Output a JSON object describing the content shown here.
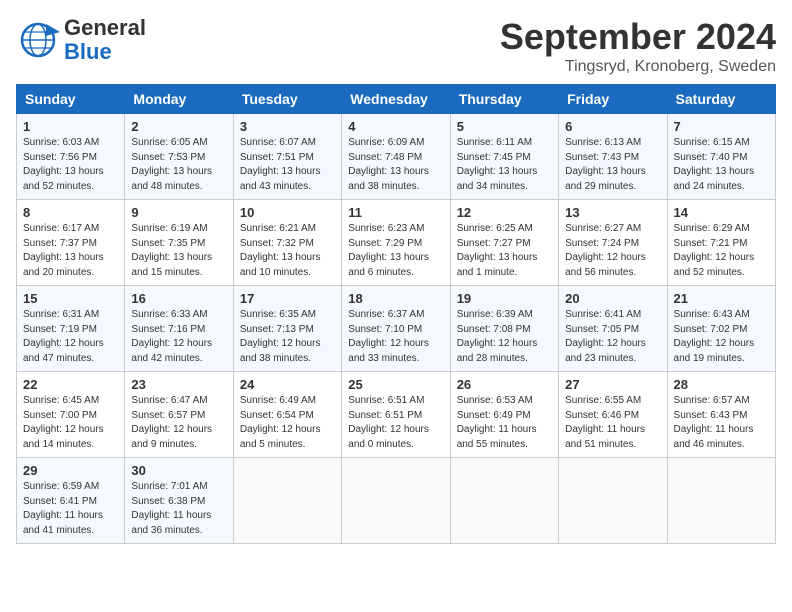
{
  "header": {
    "logo_general": "General",
    "logo_blue": "Blue",
    "month_title": "September 2024",
    "location": "Tingsryd, Kronoberg, Sweden"
  },
  "weekdays": [
    "Sunday",
    "Monday",
    "Tuesday",
    "Wednesday",
    "Thursday",
    "Friday",
    "Saturday"
  ],
  "weeks": [
    [
      {
        "day": "1",
        "info": "Sunrise: 6:03 AM\nSunset: 7:56 PM\nDaylight: 13 hours\nand 52 minutes."
      },
      {
        "day": "2",
        "info": "Sunrise: 6:05 AM\nSunset: 7:53 PM\nDaylight: 13 hours\nand 48 minutes."
      },
      {
        "day": "3",
        "info": "Sunrise: 6:07 AM\nSunset: 7:51 PM\nDaylight: 13 hours\nand 43 minutes."
      },
      {
        "day": "4",
        "info": "Sunrise: 6:09 AM\nSunset: 7:48 PM\nDaylight: 13 hours\nand 38 minutes."
      },
      {
        "day": "5",
        "info": "Sunrise: 6:11 AM\nSunset: 7:45 PM\nDaylight: 13 hours\nand 34 minutes."
      },
      {
        "day": "6",
        "info": "Sunrise: 6:13 AM\nSunset: 7:43 PM\nDaylight: 13 hours\nand 29 minutes."
      },
      {
        "day": "7",
        "info": "Sunrise: 6:15 AM\nSunset: 7:40 PM\nDaylight: 13 hours\nand 24 minutes."
      }
    ],
    [
      {
        "day": "8",
        "info": "Sunrise: 6:17 AM\nSunset: 7:37 PM\nDaylight: 13 hours\nand 20 minutes."
      },
      {
        "day": "9",
        "info": "Sunrise: 6:19 AM\nSunset: 7:35 PM\nDaylight: 13 hours\nand 15 minutes."
      },
      {
        "day": "10",
        "info": "Sunrise: 6:21 AM\nSunset: 7:32 PM\nDaylight: 13 hours\nand 10 minutes."
      },
      {
        "day": "11",
        "info": "Sunrise: 6:23 AM\nSunset: 7:29 PM\nDaylight: 13 hours\nand 6 minutes."
      },
      {
        "day": "12",
        "info": "Sunrise: 6:25 AM\nSunset: 7:27 PM\nDaylight: 13 hours\nand 1 minute."
      },
      {
        "day": "13",
        "info": "Sunrise: 6:27 AM\nSunset: 7:24 PM\nDaylight: 12 hours\nand 56 minutes."
      },
      {
        "day": "14",
        "info": "Sunrise: 6:29 AM\nSunset: 7:21 PM\nDaylight: 12 hours\nand 52 minutes."
      }
    ],
    [
      {
        "day": "15",
        "info": "Sunrise: 6:31 AM\nSunset: 7:19 PM\nDaylight: 12 hours\nand 47 minutes."
      },
      {
        "day": "16",
        "info": "Sunrise: 6:33 AM\nSunset: 7:16 PM\nDaylight: 12 hours\nand 42 minutes."
      },
      {
        "day": "17",
        "info": "Sunrise: 6:35 AM\nSunset: 7:13 PM\nDaylight: 12 hours\nand 38 minutes."
      },
      {
        "day": "18",
        "info": "Sunrise: 6:37 AM\nSunset: 7:10 PM\nDaylight: 12 hours\nand 33 minutes."
      },
      {
        "day": "19",
        "info": "Sunrise: 6:39 AM\nSunset: 7:08 PM\nDaylight: 12 hours\nand 28 minutes."
      },
      {
        "day": "20",
        "info": "Sunrise: 6:41 AM\nSunset: 7:05 PM\nDaylight: 12 hours\nand 23 minutes."
      },
      {
        "day": "21",
        "info": "Sunrise: 6:43 AM\nSunset: 7:02 PM\nDaylight: 12 hours\nand 19 minutes."
      }
    ],
    [
      {
        "day": "22",
        "info": "Sunrise: 6:45 AM\nSunset: 7:00 PM\nDaylight: 12 hours\nand 14 minutes."
      },
      {
        "day": "23",
        "info": "Sunrise: 6:47 AM\nSunset: 6:57 PM\nDaylight: 12 hours\nand 9 minutes."
      },
      {
        "day": "24",
        "info": "Sunrise: 6:49 AM\nSunset: 6:54 PM\nDaylight: 12 hours\nand 5 minutes."
      },
      {
        "day": "25",
        "info": "Sunrise: 6:51 AM\nSunset: 6:51 PM\nDaylight: 12 hours\nand 0 minutes."
      },
      {
        "day": "26",
        "info": "Sunrise: 6:53 AM\nSunset: 6:49 PM\nDaylight: 11 hours\nand 55 minutes."
      },
      {
        "day": "27",
        "info": "Sunrise: 6:55 AM\nSunset: 6:46 PM\nDaylight: 11 hours\nand 51 minutes."
      },
      {
        "day": "28",
        "info": "Sunrise: 6:57 AM\nSunset: 6:43 PM\nDaylight: 11 hours\nand 46 minutes."
      }
    ],
    [
      {
        "day": "29",
        "info": "Sunrise: 6:59 AM\nSunset: 6:41 PM\nDaylight: 11 hours\nand 41 minutes."
      },
      {
        "day": "30",
        "info": "Sunrise: 7:01 AM\nSunset: 6:38 PM\nDaylight: 11 hours\nand 36 minutes."
      },
      {
        "day": "",
        "info": ""
      },
      {
        "day": "",
        "info": ""
      },
      {
        "day": "",
        "info": ""
      },
      {
        "day": "",
        "info": ""
      },
      {
        "day": "",
        "info": ""
      }
    ]
  ]
}
